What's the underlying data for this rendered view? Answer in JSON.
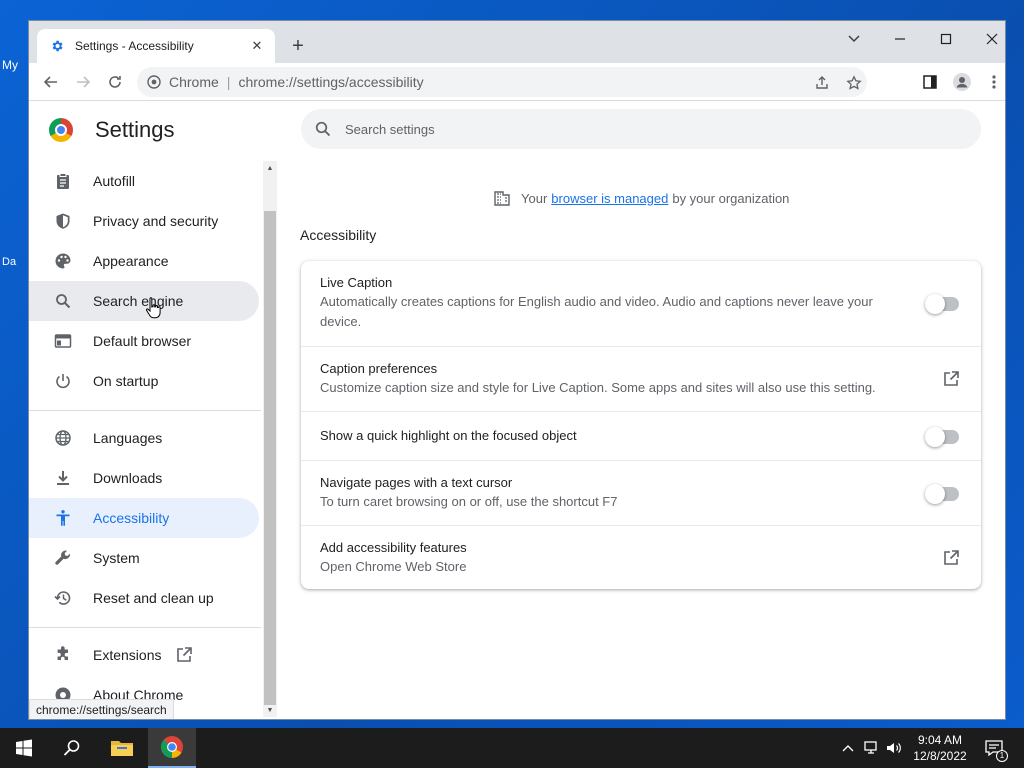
{
  "desktop": {
    "frag1": "My",
    "frag2": "Da"
  },
  "tab": {
    "title": "Settings - Accessibility",
    "close": "✕",
    "new_tab": "+"
  },
  "window_controls": {
    "tab_search": "⌄",
    "minimize": "—",
    "maximize": "☐",
    "close": "✕"
  },
  "omnibox": {
    "site": "Chrome",
    "separator": "|",
    "url": "chrome://settings/accessibility"
  },
  "settings": {
    "title": "Settings",
    "search_placeholder": "Search settings",
    "nav": [
      {
        "label": "Autofill",
        "icon": "clipboard-icon"
      },
      {
        "label": "Privacy and security",
        "icon": "shield-icon"
      },
      {
        "label": "Appearance",
        "icon": "palette-icon"
      },
      {
        "label": "Search engine",
        "icon": "search-icon"
      },
      {
        "label": "Default browser",
        "icon": "browser-icon"
      },
      {
        "label": "On startup",
        "icon": "power-icon"
      },
      {
        "label": "Languages",
        "icon": "globe-icon"
      },
      {
        "label": "Downloads",
        "icon": "download-icon"
      },
      {
        "label": "Accessibility",
        "icon": "accessibility-icon"
      },
      {
        "label": "System",
        "icon": "wrench-icon"
      },
      {
        "label": "Reset and clean up",
        "icon": "history-icon"
      },
      {
        "label": "Extensions",
        "icon": "puzzle-icon"
      },
      {
        "label": "About Chrome",
        "icon": "chrome-icon"
      }
    ],
    "managed": {
      "prefix": "Your",
      "link": "browser is managed",
      "suffix": "by your organization"
    },
    "section_title": "Accessibility",
    "rows": [
      {
        "title": "Live Caption",
        "subtitle": "Automatically creates captions for English audio and video. Audio and captions never leave your device.",
        "control": "toggle",
        "checked": false
      },
      {
        "title": "Caption preferences",
        "subtitle": "Customize caption size and style for Live Caption. Some apps and sites will also use this setting.",
        "control": "external-link"
      },
      {
        "title": "Show a quick highlight on the focused object",
        "subtitle": "",
        "control": "toggle",
        "checked": false
      },
      {
        "title": "Navigate pages with a text cursor",
        "subtitle": "To turn caret browsing on or off, use the shortcut F7",
        "control": "toggle",
        "checked": false
      },
      {
        "title": "Add accessibility features",
        "subtitle": "Open Chrome Web Store",
        "control": "external-link"
      }
    ]
  },
  "status_bar": "chrome://settings/search",
  "taskbar": {
    "time": "9:04 AM",
    "date": "12/8/2022",
    "notifications": "1"
  },
  "colors": {
    "accent": "#1a73e8",
    "active_bg": "#e8f0fe",
    "hover_bg": "#e8eaed",
    "taskbar": "#1c1c1c"
  }
}
